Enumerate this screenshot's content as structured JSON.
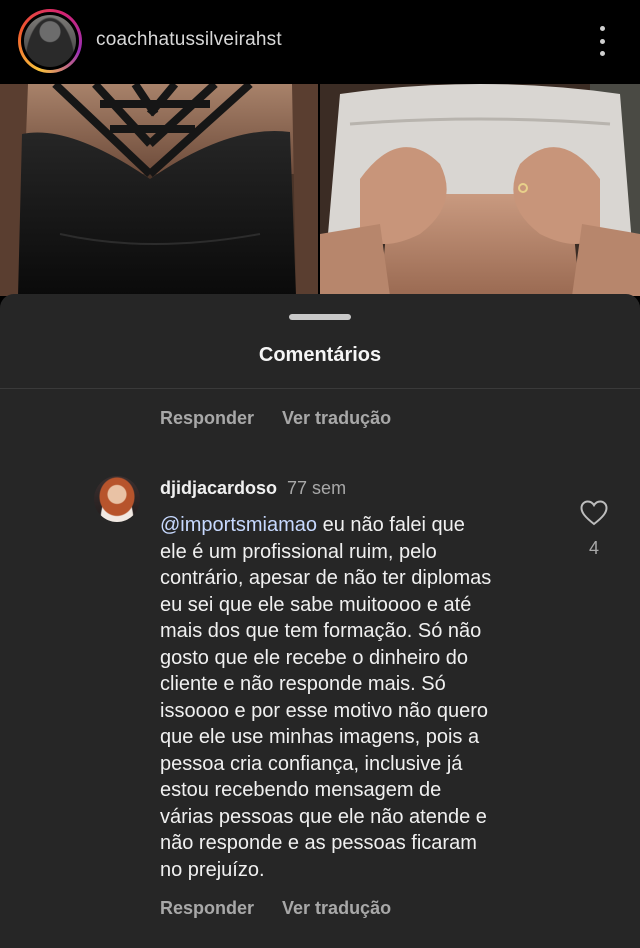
{
  "post": {
    "username": "coachhatussilveirahst",
    "more_icon": "more-vertical-icon",
    "images": [
      "left-photo",
      "right-photo"
    ]
  },
  "comments_sheet": {
    "title": "Comentários",
    "previous_actions": {
      "reply": "Responder",
      "see_translation": "Ver tradução"
    },
    "comment": {
      "username": "djidjacardoso",
      "time": "77 sem",
      "mention": "@importsmiamao",
      "text_lines": [
        " eu não falei que",
        "ele é um profissional ruim, pelo",
        "contrário, apesar de não ter diplomas",
        "eu sei que ele sabe muitoooo e até",
        "mais dos que tem formação. Só não",
        "gosto que ele recebe o dinheiro do",
        "cliente e não responde mais. Só",
        "issoooo e por esse motivo não quero",
        "que ele use minhas imagens, pois a",
        "pessoa cria confiança, inclusive já",
        "estou recebendo mensagem de",
        "várias pessoas que ele não atende e",
        "não responde e as pessoas ficaram",
        "no prejuízo."
      ],
      "likes": "4",
      "like_icon": "heart-icon",
      "actions": {
        "reply": "Responder",
        "see_translation": "Ver tradução"
      }
    }
  },
  "colors": {
    "background": "#000000",
    "sheet": "#262626",
    "mention": "#c7d9ff",
    "muted": "#a8a8a8"
  }
}
